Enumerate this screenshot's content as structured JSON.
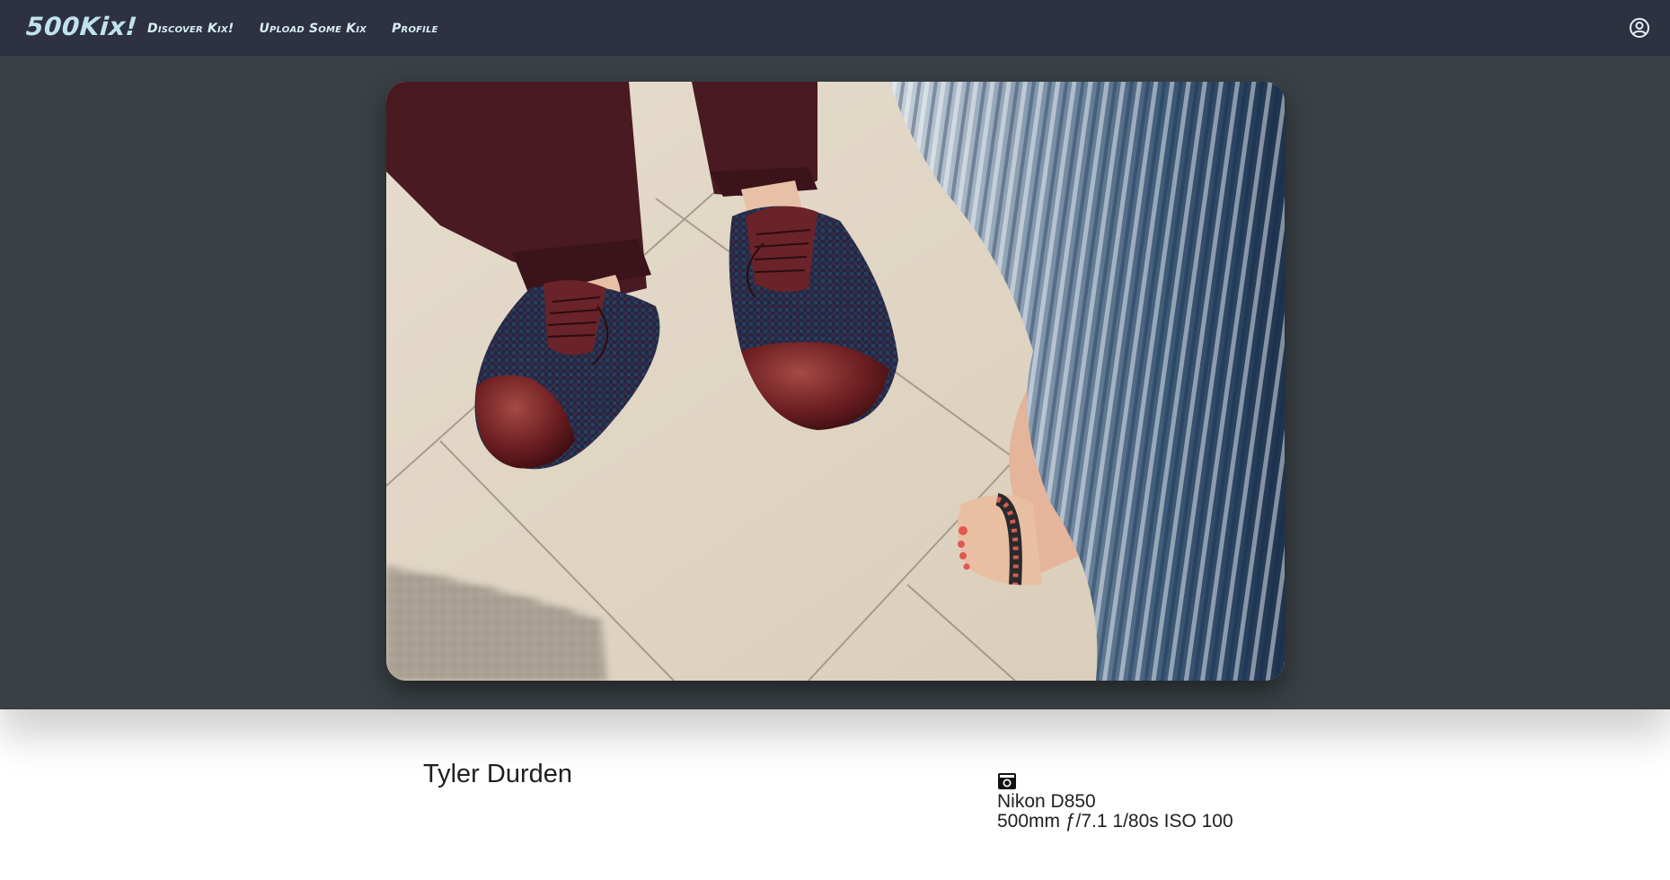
{
  "navbar": {
    "brand": "500Kix!",
    "links": [
      {
        "label": "Discover Kix!"
      },
      {
        "label": "Upload Some Kix"
      },
      {
        "label": "Profile"
      }
    ],
    "user_icon": "user-circle-icon",
    "background": "#2d3142",
    "accent": "#bfe3ee"
  },
  "hero": {
    "background": "#3a4145",
    "photo_subject": "shoes-photo"
  },
  "info": {
    "photographer": "Tyler Durden",
    "camera_icon": "camera-icon",
    "camera": "Nikon D850",
    "settings": "500mm ƒ/7.1 1/80s ISO 100"
  }
}
